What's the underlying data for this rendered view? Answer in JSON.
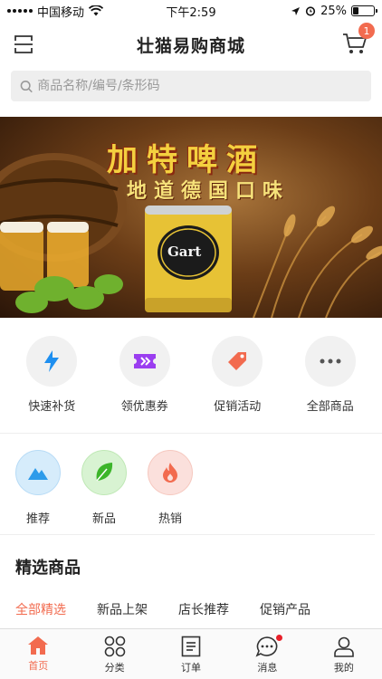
{
  "status": {
    "carrier": "中国移动",
    "time": "下午2:59",
    "battery_text": "25%",
    "battery_level": 0.25
  },
  "header": {
    "title": "壮猫易购商城",
    "cart_count": "1"
  },
  "search": {
    "placeholder": "商品名称/编号/条形码"
  },
  "banner": {
    "headline": "加特啤酒",
    "subline": "地道德国口味",
    "can_brand": "Gart"
  },
  "quick_actions": [
    {
      "label": "快速补货",
      "icon": "lightning-icon",
      "color": "#1e8ff0"
    },
    {
      "label": "领优惠券",
      "icon": "coupon-icon",
      "color": "#9b3ef0"
    },
    {
      "label": "促销活动",
      "icon": "tag-icon",
      "color": "#f26b4f"
    },
    {
      "label": "全部商品",
      "icon": "more-icon",
      "color": "#555555"
    }
  ],
  "categories": [
    {
      "label": "推荐",
      "icon": "mountain-icon",
      "bg": "#d6ecfb",
      "color": "#2d9bea"
    },
    {
      "label": "新品",
      "icon": "leaf-icon",
      "bg": "#d8f3d2",
      "color": "#3cb52a"
    },
    {
      "label": "热销",
      "icon": "flame-icon",
      "bg": "#fbe0dc",
      "color": "#f26b4f"
    }
  ],
  "featured": {
    "title": "精选商品",
    "tabs": [
      "全部精选",
      "新品上架",
      "店长推荐",
      "促销产品"
    ],
    "active_tab": 0
  },
  "bottom_nav": [
    {
      "label": "首页",
      "icon": "home-icon"
    },
    {
      "label": "分类",
      "icon": "grid-icon"
    },
    {
      "label": "订单",
      "icon": "order-icon"
    },
    {
      "label": "消息",
      "icon": "message-icon"
    },
    {
      "label": "我的",
      "icon": "user-icon"
    }
  ],
  "colors": {
    "accent": "#f26b4f",
    "notification_dot": "#e8202a"
  }
}
